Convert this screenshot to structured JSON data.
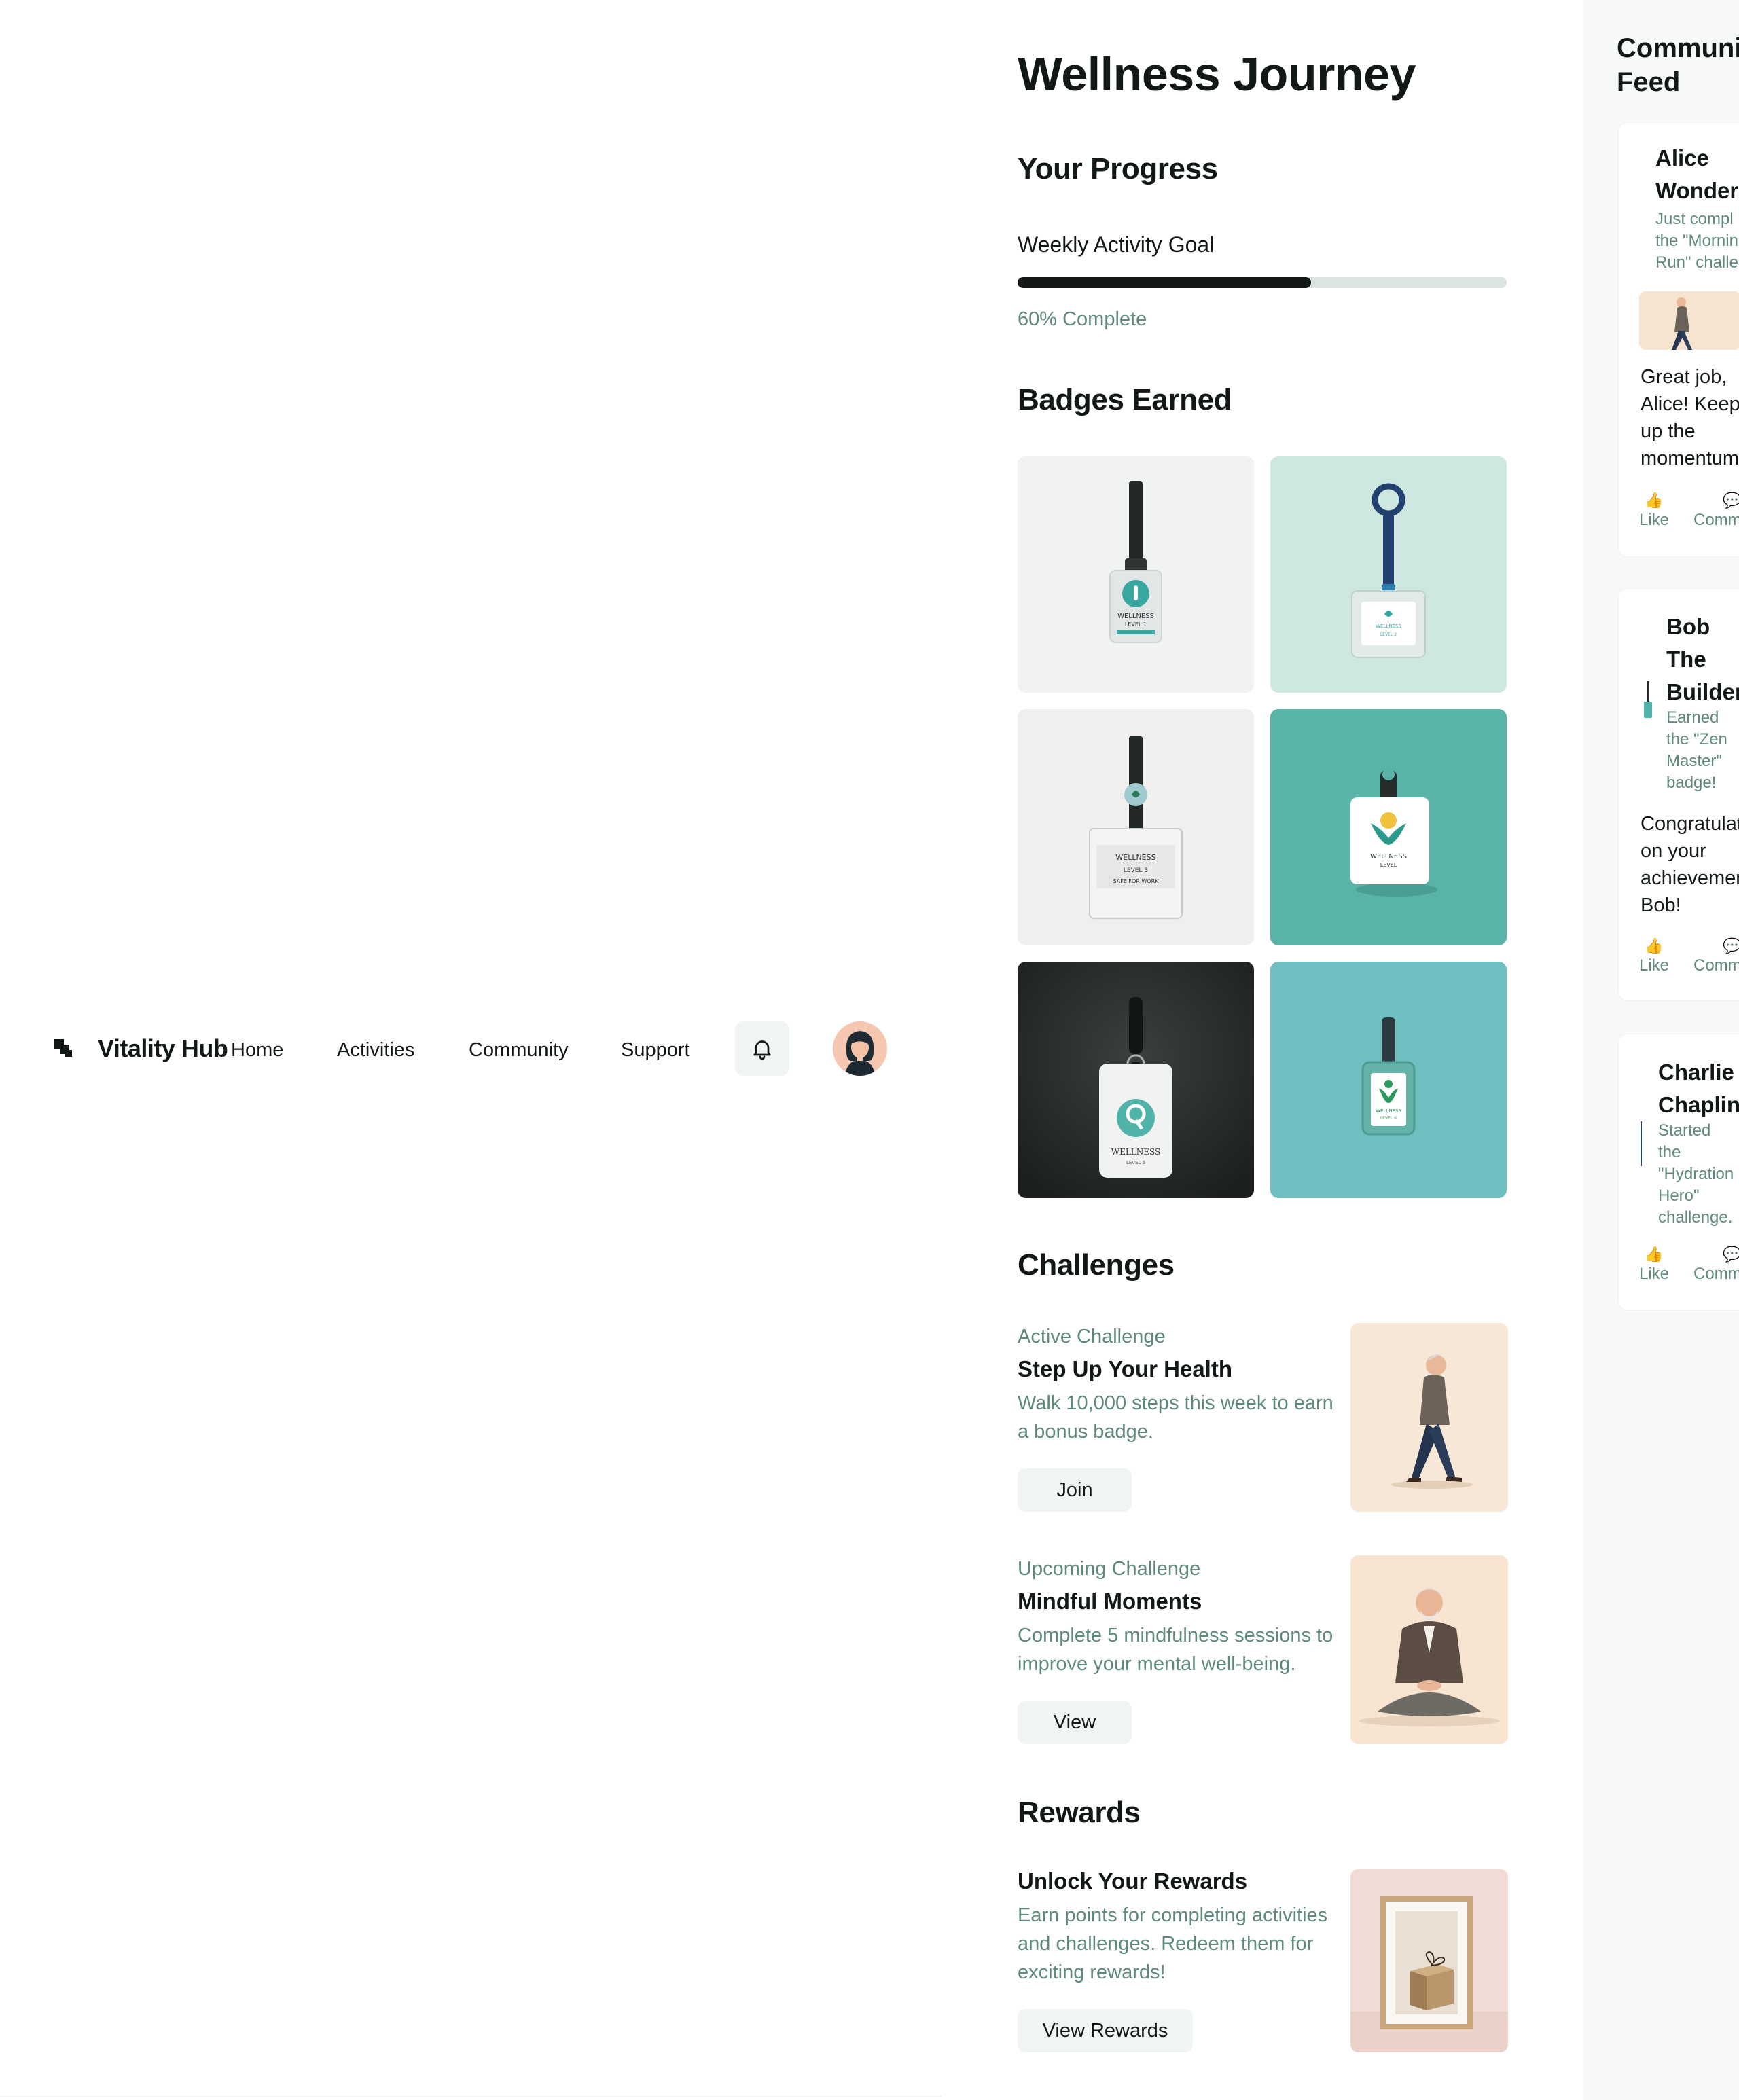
{
  "header": {
    "brand": "Vitality Hub",
    "nav": [
      "Home",
      "Activities",
      "Community",
      "Support"
    ],
    "notifications_icon": "bell-icon",
    "avatar_icon": "user-avatar"
  },
  "main": {
    "title": "Wellness Journey",
    "progress": {
      "heading": "Your Progress",
      "goal_label": "Weekly Activity Goal",
      "percent": 60,
      "percent_text": "60% Complete"
    },
    "badges": {
      "heading": "Badges Earned",
      "items": [
        {
          "lines": [
            "WELLNESS",
            "LEVEL 1"
          ]
        },
        {
          "lines": [
            "WELLNESS",
            "LEVEL 2"
          ]
        },
        {
          "lines": [
            "WELLNESS",
            "LEVEL 3",
            "SAFE FOR WORK"
          ]
        },
        {
          "lines": [
            "WELLNESS",
            "LEVEL"
          ]
        },
        {
          "lines": [
            "WELLNESS",
            "LEVEL 5"
          ]
        },
        {
          "lines": [
            "WELLNESS",
            "LEVEL 6"
          ]
        }
      ]
    },
    "challenges": {
      "heading": "Challenges",
      "items": [
        {
          "tag": "Active Challenge",
          "title": "Step Up Your Health",
          "desc": "Walk 10,000 steps this week to earn a bonus badge.",
          "button": "Join"
        },
        {
          "tag": "Upcoming Challenge",
          "title": "Mindful Moments",
          "desc": "Complete 5 mindfulness sessions to improve your mental well-being.",
          "button": "View"
        }
      ]
    },
    "rewards": {
      "heading": "Rewards",
      "title": "Unlock Your Rewards",
      "desc": "Earn points for completing activities and challenges. Redeem them for exciting rewards!",
      "button": "View Rewards"
    }
  },
  "feed": {
    "title_line1": "Communi",
    "title_line2": "Feed",
    "posts": [
      {
        "name_lines": [
          "Alice",
          "Wonder"
        ],
        "activity_lines": [
          "Just compl",
          "the \"Mornin",
          "Run\" challe"
        ],
        "comment_lines": [
          "Great job,",
          "Alice! Keep",
          "up the",
          "momentum!"
        ],
        "like": "Like",
        "comment": "Comm"
      },
      {
        "name_lines": [
          "Bob",
          "The",
          "Builder"
        ],
        "activity_lines": [
          "Earned",
          "the \"Zen",
          "Master\"",
          "badge!"
        ],
        "comment_lines": [
          "Congratulat",
          "on your",
          "achievemen",
          "Bob!"
        ],
        "like": "Like",
        "comment": "Comm"
      },
      {
        "name_lines": [
          "Charlie",
          "Chaplin"
        ],
        "activity_lines": [
          "Started",
          "the",
          "\"Hydration",
          "Hero\"",
          "challenge."
        ],
        "like": "Like",
        "comment": "Comm"
      }
    ],
    "like_icon": "thumbs-up-icon",
    "comment_icon": "speech-bubble-icon"
  },
  "colors": {
    "text": "#121717",
    "muted": "#5e8a7a",
    "button_bg": "#f0f4f4",
    "teal": "#4fb3a9",
    "progress_track": "#dce4e2",
    "feed_bg": "#f7f9f9"
  }
}
